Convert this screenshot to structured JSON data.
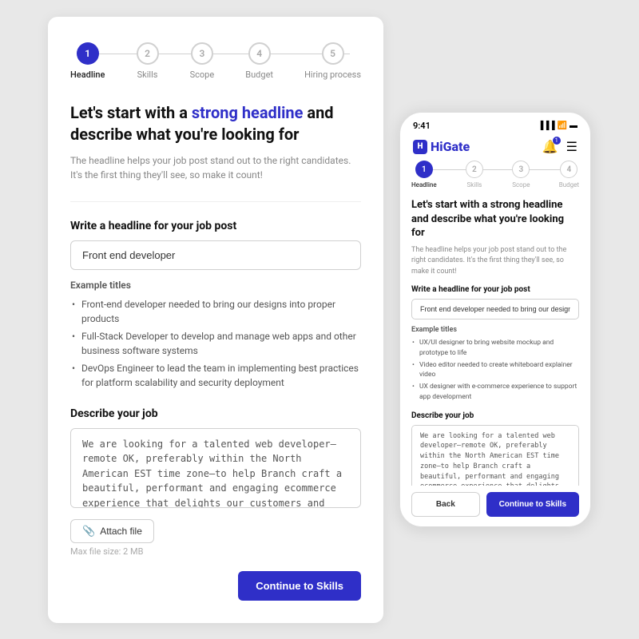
{
  "colors": {
    "primary": "#2f2fc8",
    "text": "#111",
    "muted": "#888",
    "border": "#d0d0d0"
  },
  "desktop": {
    "steps": [
      {
        "number": "1",
        "label": "Headline",
        "active": true
      },
      {
        "number": "2",
        "label": "Skills",
        "active": false
      },
      {
        "number": "3",
        "label": "Scope",
        "active": false
      },
      {
        "number": "4",
        "label": "Budget",
        "active": false
      },
      {
        "number": "5",
        "label": "Hiring process",
        "active": false
      }
    ],
    "headline_part1": "Let's start with a ",
    "headline_highlight": "strong headline",
    "headline_part2": " and describe what you're looking for",
    "subtitle": "The headline helps your job post stand out to the right candidates. It's the first thing they'll see, so make it count!",
    "write_label": "Write a headline for your job post",
    "input_value": "Front end developer",
    "example_titles_label": "Example titles",
    "examples": [
      "Front-end developer needed to bring our designs into proper products",
      "Full-Stack Developer to develop and manage web apps and other business software systems",
      "DevOps Engineer to lead the team in implementing best practices for platform scalability and security deployment"
    ],
    "describe_label": "Describe your job",
    "textarea_value": "We are looking for a talented web developer—remote OK, preferably within the North American EST time zone—to help Branch craft a beautiful, performant and engaging ecommerce experience that delights our customers and boosts conversion and order value....",
    "attach_label": "Attach file",
    "max_file": "Max file size: 2 MB",
    "continue_label": "Continue to Skills"
  },
  "mobile": {
    "status_time": "9:41",
    "logo": "HiGate",
    "notification_count": "1",
    "steps": [
      {
        "number": "1",
        "label": "Headline",
        "active": true
      },
      {
        "number": "2",
        "label": "Skills",
        "active": false
      },
      {
        "number": "3",
        "label": "Scope",
        "active": false
      },
      {
        "number": "4",
        "label": "Budget",
        "active": false
      }
    ],
    "headline": "Let's start with a strong headline and describe what you're looking for",
    "subtitle": "The headline helps your job post stand out to the right candidates. It's the first thing they'll see, so make it count!",
    "write_label": "Write a headline for your job post",
    "input_value": "Front end developer needed to bring our designs into proper products",
    "example_titles_label": "Example titles",
    "examples": [
      "UX/UI designer to bring website mockup and prototype to life",
      "Video editor needed to create whiteboard explainer video",
      "UX designer with e-commerce experience to support app development"
    ],
    "describe_label": "Describe your job",
    "textarea_value": "We are looking for a talented web developer—remote OK, preferably within the North American EST time zone—to help Branch craft a beautiful, performant and engaging ecommerce experience that delights our customers and boosts conversion and order value.\nAs one of the first developers at Branch, you'll work closely with our digital product team to build best-in-class front-end",
    "back_label": "Back",
    "continue_label": "Continue to Skills"
  }
}
